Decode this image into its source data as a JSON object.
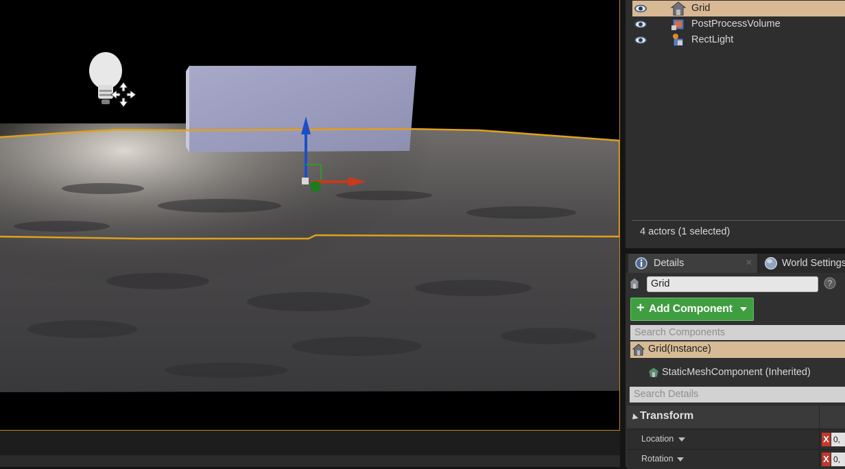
{
  "outliner": {
    "items": [
      {
        "label": "Grid",
        "selected": true,
        "icon": "house-actor-icon"
      },
      {
        "label": "PostProcessVolume",
        "selected": false,
        "icon": "postprocess-volume-icon"
      },
      {
        "label": "RectLight",
        "selected": false,
        "icon": "rect-light-icon"
      }
    ],
    "actor_count": "4 actors (1 selected)"
  },
  "details": {
    "tabs": [
      {
        "label": "Details",
        "icon": "info-icon",
        "active": true
      },
      {
        "label": "World Settings",
        "icon": "globe-icon",
        "active": false
      }
    ],
    "actor_name": "Grid",
    "add_component_label": "Add Component",
    "search_components_placeholder": "Search Components",
    "components": [
      {
        "label": "Grid(Instance)",
        "selected": true
      },
      {
        "label": "StaticMeshComponent (Inherited)",
        "selected": false
      }
    ],
    "search_details_placeholder": "Search Details",
    "transform": {
      "section_label": "Transform",
      "rows": [
        {
          "label": "Location",
          "axis_badge": "X",
          "value": "0,"
        },
        {
          "label": "Rotation",
          "axis_badge": "X",
          "value": "0,"
        }
      ]
    }
  },
  "colors": {
    "selection": "#d9b894",
    "add_component": "#3f9e3f",
    "viewport_outline": "#c48a1c",
    "x_axis": "#c0392b"
  }
}
